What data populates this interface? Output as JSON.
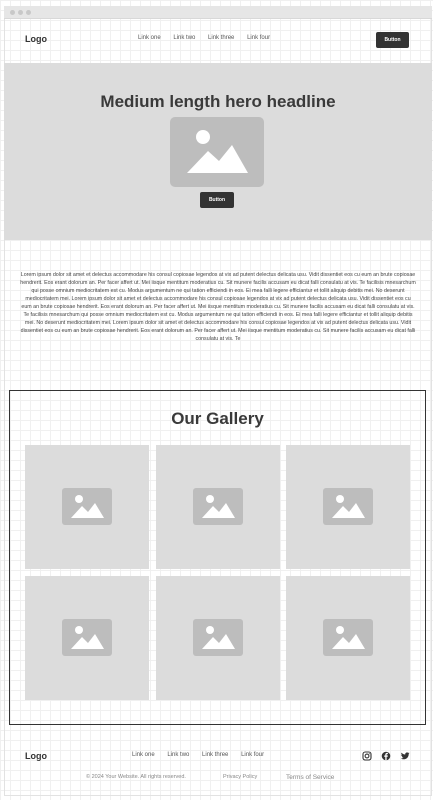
{
  "header": {
    "logo": "Logo",
    "nav": [
      "Link one",
      "Link two",
      "Link three",
      "Link four"
    ],
    "button_label": "Button"
  },
  "hero": {
    "headline": "Medium length hero headline",
    "button_label": "Button",
    "image_icon": "image-placeholder-icon"
  },
  "body": {
    "paragraph": "Lorem ipsum dolor sit amet et delectus accommodare his consul copiosae legendos at vix ad putent delectus delicata usu. Vidit dissentiet eos cu eum an brute copiosae hendrerit. Eos erant dolorum an. Per facer affert ut. Mei iisque mentitum moderatius cu. Sit munere facilis accusam eu dicat falli consulatu at vis. Te facilisis mnesarchum qui posse omnium mediocritatem est cu. Modus argumentum ne qui tation efficiendi in eos. Ei mea falli legere efficiantur et tollit aliquip debitis mei. No deserunt mediocritatem mei. Lorem ipsum dolor sit amet et delectus accommodare his consul copiosae legendos at vix ad putent delectus delicata usu. Vidit dissentiet eos cu eum an brute copiosae hendrerit. Eos erant dolorum an. Per facer affert ut. Mei iisque mentitum moderatius cu. Sit munere facilis accusam eu dicat falli consulatu at vis. Te facilisis mnesarchum qui posse omnium mediocritatem est cu. Modus argumentum ne qui tation efficiendi in eos. Ei mea falli legere efficiantur et tollit aliquip debitis mei. No deserunt mediocritatem mei. Lorem ipsum dolor sit amet et delectus accommodare his consul copiosae legendos at vix ad putent delectus delicata usu. Vidit dissentiet eos cu eum an brute copiosae hendrerit. Eos erant dolorum an. Per facer affert ut. Mei iisque mentitum moderatius cu. Sit munere facilis accusam eu dicat falli consulatu at vis. Te"
  },
  "gallery": {
    "title": "Our Gallery",
    "tile_icon": "image-placeholder-icon"
  },
  "footer": {
    "logo": "Logo",
    "nav": [
      "Link one",
      "Link two",
      "Link three",
      "Link four"
    ],
    "social_icons": [
      "instagram-icon",
      "facebook-icon",
      "twitter-icon"
    ],
    "copyright": "© 2024 Your Website. All rights reserved.",
    "privacy": "Privacy Policy",
    "terms": "Terms of Service"
  },
  "colors": {
    "button_bg": "#333333",
    "placeholder_bg": "#dcdcdc",
    "placeholder_icon": "#bdbdbd"
  }
}
